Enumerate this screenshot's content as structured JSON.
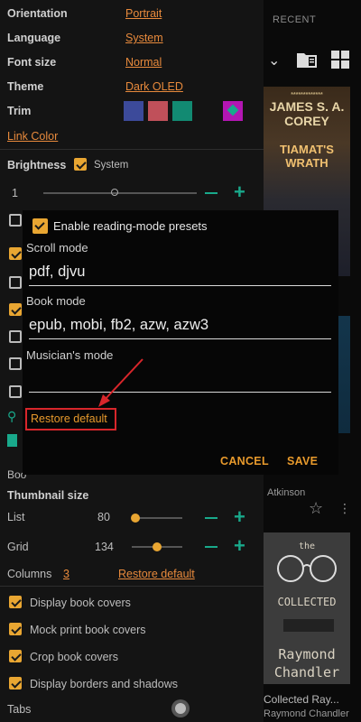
{
  "library": {
    "recent_label": "RECENT",
    "book1": {
      "author": "JAMES S. A. COREY",
      "title": "TIAMAT'S WRATH"
    },
    "book2": {
      "author_fragment": "Atkinson"
    },
    "book3": {
      "title": "Collected Ray...",
      "author": "Raymond Chandler",
      "cover_lines": [
        "the",
        "COLLECTED",
        "Raymond",
        "Chandler"
      ]
    }
  },
  "settings": {
    "orientation": {
      "label": "Orientation",
      "value": "Portrait"
    },
    "language": {
      "label": "Language",
      "value": "System"
    },
    "font_size": {
      "label": "Font size",
      "value": "Normal"
    },
    "theme": {
      "label": "Theme",
      "value": "Dark OLED"
    },
    "trim": {
      "label": "Trim",
      "swatches": [
        "#3c4a9a",
        "#c0505a",
        "#128a72",
        "#b316b3"
      ]
    },
    "link_color": "Link Color",
    "brightness": {
      "label": "Brightness",
      "system_label": "System",
      "value": "1"
    },
    "thumbnail_size": {
      "label": "Thumbnail size",
      "list": {
        "label": "List",
        "value": "80",
        "level": 0.08
      },
      "grid": {
        "label": "Grid",
        "value": "134",
        "level": 0.5
      }
    },
    "columns": {
      "label": "Columns",
      "value": "3",
      "restore": "Restore default"
    },
    "bo_fragment": "Boo",
    "options": [
      {
        "label": "Display book covers",
        "checked": true
      },
      {
        "label": "Mock print book covers",
        "checked": true
      },
      {
        "label": "Crop book covers",
        "checked": true
      },
      {
        "label": "Display borders and shadows",
        "checked": true
      }
    ],
    "tabs_label": "Tabs"
  },
  "dialog": {
    "enable_label": "Enable reading-mode presets",
    "scroll_mode": {
      "label": "Scroll mode",
      "value": "pdf, djvu"
    },
    "book_mode": {
      "label": "Book mode",
      "value": "epub, mobi, fb2, azw, azw3"
    },
    "musician_mode": {
      "label": "Musician's mode",
      "value": ""
    },
    "restore_default": "Restore default",
    "cancel": "CANCEL",
    "save": "SAVE"
  },
  "colors": {
    "accent": "#e9a632",
    "link": "#e88a3c",
    "teal": "#19a98b",
    "highlight": "#d8262b"
  }
}
